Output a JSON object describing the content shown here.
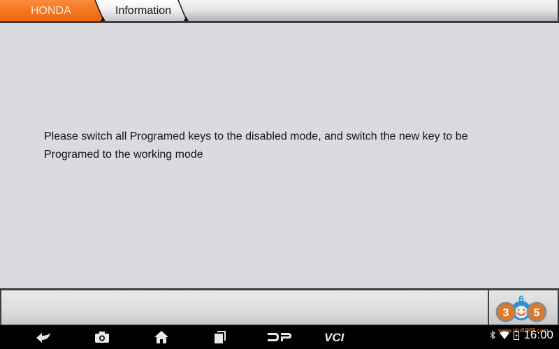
{
  "header": {
    "breadcrumbs": [
      {
        "label": "HONDA",
        "active": true
      },
      {
        "label": "Information",
        "active": false
      }
    ]
  },
  "main": {
    "message_line1": "Please switch all Programed keys to the disabled mode,  and switch the new key to be",
    "message_line2": "Programed to the working mode"
  },
  "watermark": {
    "logo_digits": [
      "3",
      "6",
      "5"
    ],
    "url": "www.obdii365.com"
  },
  "navbar": {
    "buttons": [
      {
        "icon": "back-icon"
      },
      {
        "icon": "camera-icon"
      },
      {
        "icon": "home-icon"
      },
      {
        "icon": "recent-apps-icon"
      },
      {
        "label": "DP"
      },
      {
        "label": "VCI"
      }
    ]
  },
  "status_bar": {
    "time": "16:00",
    "icons": [
      "bluetooth-icon",
      "wifi-icon",
      "battery-icon"
    ]
  },
  "colors": {
    "accent": "#f47520",
    "content_bg": "#d9dbde",
    "navbar_bg": "#000000"
  }
}
